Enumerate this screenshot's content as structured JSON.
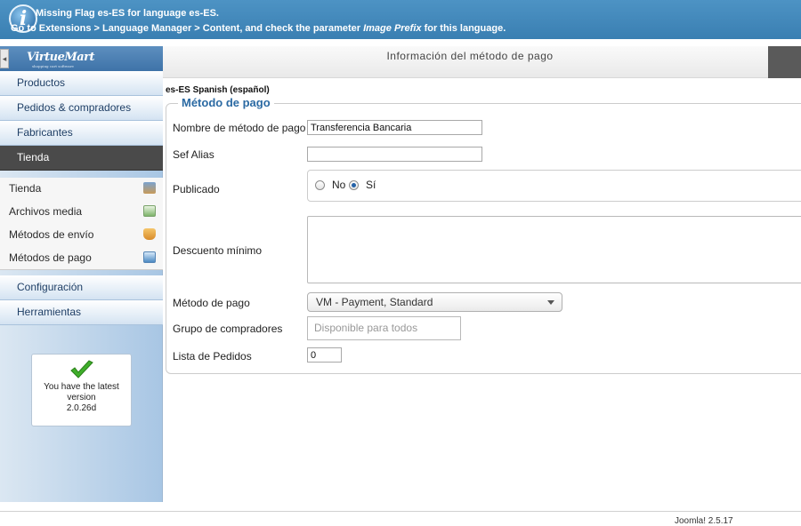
{
  "notice": {
    "line1": "Missing Flag es-ES for language es-ES.",
    "line2_pre": "Go to Extensions > Language Manager > Content, and check the parameter ",
    "line2_em": "Image Prefix",
    "line2_post": " for this language."
  },
  "sidebar": {
    "logo": "VirtueMart",
    "logo_tagline": "shopping cart software",
    "collapse_glyph": "◂",
    "nav_items": [
      {
        "label": "Productos"
      },
      {
        "label": "Pedidos & compradores"
      },
      {
        "label": "Fabricantes"
      },
      {
        "label": "Tienda",
        "active": true
      },
      {
        "label": "Configuración"
      },
      {
        "label": "Herramientas"
      }
    ],
    "sub_items": [
      {
        "label": "Tienda",
        "icon": "store-icon"
      },
      {
        "label": "Archivos media",
        "icon": "media-icon"
      },
      {
        "label": "Métodos de envío",
        "icon": "truck-icon"
      },
      {
        "label": "Métodos de pago",
        "icon": "payment-icon"
      }
    ],
    "version_box": {
      "line1": "You have the latest",
      "line2": "version",
      "line3": "2.0.26d"
    }
  },
  "main": {
    "header_title": "Información del método de pago",
    "language_label": "es-ES Spanish (español)",
    "legend": "Método de pago",
    "fields": {
      "name_label": "Nombre de método de pago",
      "name_value": "Transferencia Bancaria",
      "sef_label": "Sef Alias",
      "sef_value": "",
      "published_label": "Publicado",
      "published_no": "No",
      "published_yes": "Sí",
      "published_selected": "Sí",
      "min_discount_label": "Descuento mínimo",
      "payment_method_label": "Método de pago",
      "payment_method_value": "VM - Payment, Standard",
      "shopper_group_label": "Grupo de compradores",
      "shopper_group_placeholder": "Disponible para todos",
      "ordering_label": "Lista de Pedidos",
      "ordering_value": "0"
    }
  },
  "footer": {
    "version": "Joomla! 2.5.17"
  },
  "colors": {
    "notice_bg": "#3a7fb2",
    "accent": "#2b6aa3",
    "active_nav": "#4a4a4a"
  }
}
